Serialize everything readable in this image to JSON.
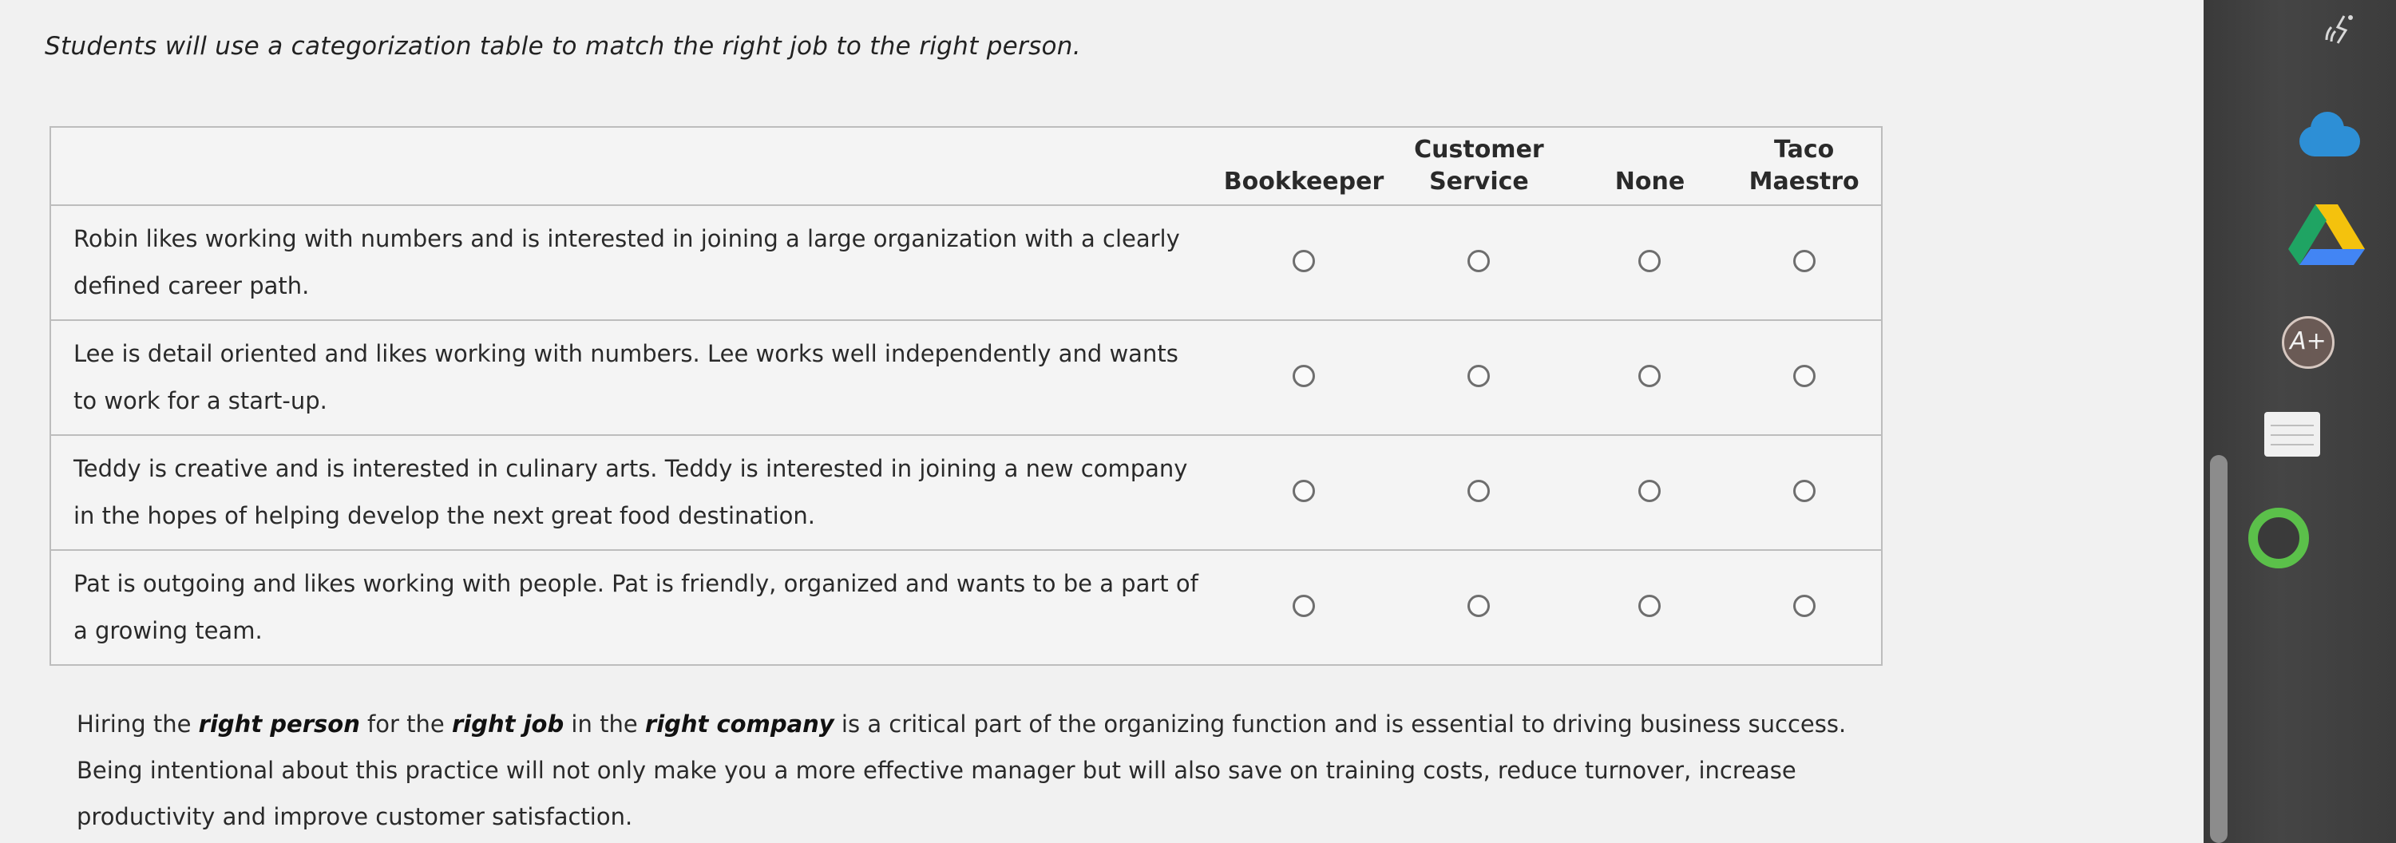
{
  "intro_text": "Students will use a categorization table to match the right job to the right person.",
  "table": {
    "columns": [
      {
        "line1": "",
        "line2": "Bookkeeper"
      },
      {
        "line1": "Customer",
        "line2": "Service"
      },
      {
        "line1": "",
        "line2": "None"
      },
      {
        "line1": "Taco",
        "line2": "Maestro"
      }
    ],
    "rows": [
      {
        "statement": "Robin likes working with numbers and is interested in joining a large organization with a clearly defined career path."
      },
      {
        "statement": "Lee is detail oriented and likes working with numbers. Lee works well independently and wants to work for a start-up."
      },
      {
        "statement": "Teddy is creative and is interested in culinary arts. Teddy is interested in joining a new company in the hopes of helping develop the next great food destination."
      },
      {
        "statement": "Pat is outgoing and likes working with people. Pat is friendly, organized and wants to be a part of a growing team."
      }
    ]
  },
  "summary": {
    "p1": "Hiring the ",
    "b1": "right person",
    "p2": " for the ",
    "b2": "right job",
    "p3": " in the ",
    "b3": "right company",
    "p4": " is a critical part of the organizing function and is essential to driving business success. Being intentional about this practice will not only make you a more effective manager but will also save on training costs, reduce turnover, increase productivity and improve customer satisfaction."
  },
  "sidebar": {
    "icons": [
      "wifi-icon",
      "cloud-icon",
      "google-drive-icon",
      "a-plus-icon",
      "notes-icon",
      "ring-icon"
    ],
    "aplus_label": "A+",
    "colors": {
      "cloud": "#2d8fd6",
      "ring": "#5bc04a"
    }
  }
}
